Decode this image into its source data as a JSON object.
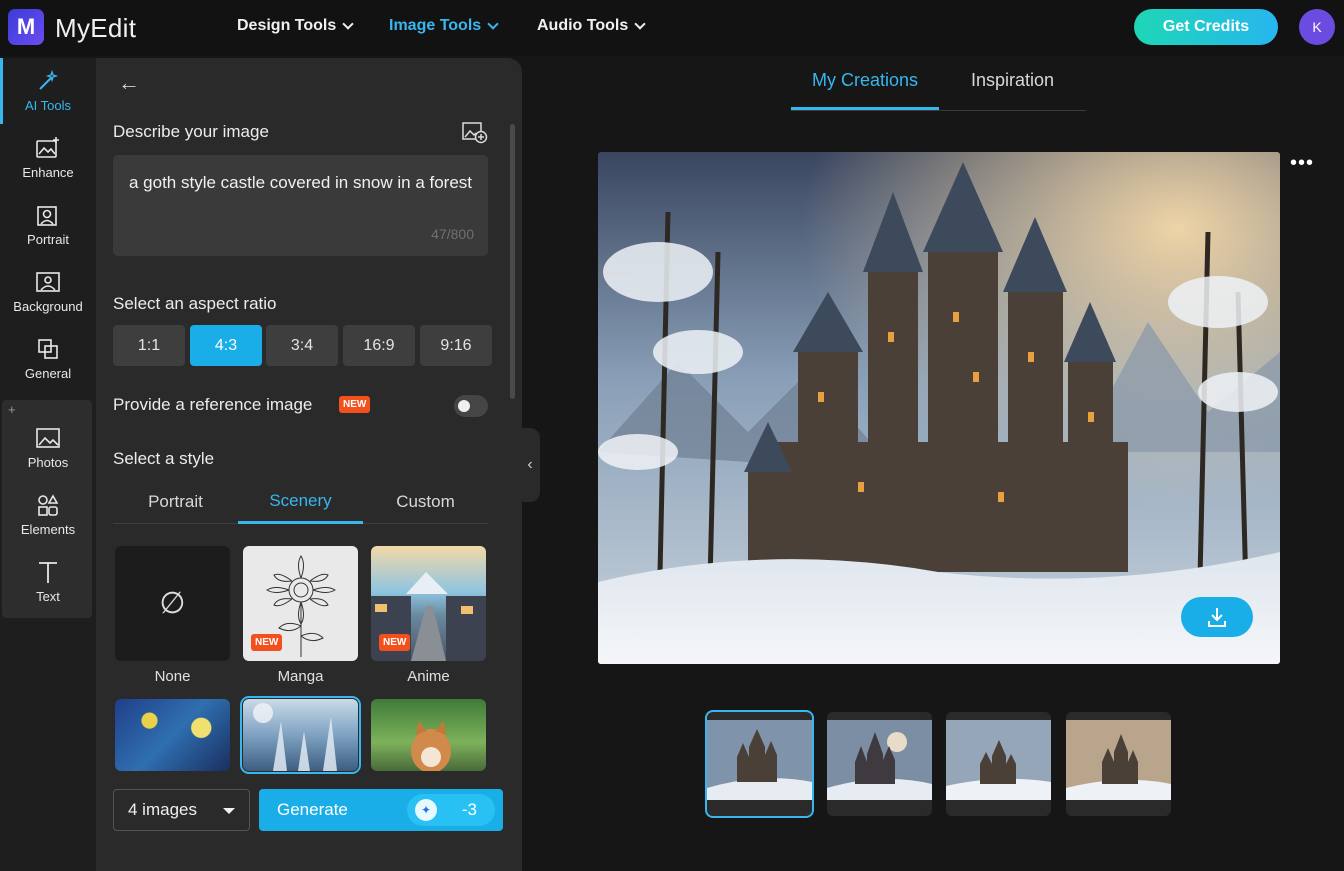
{
  "brand": {
    "name": "MyEdit",
    "mark": "M"
  },
  "nav": [
    {
      "label": "Design Tools"
    },
    {
      "label": "Image Tools"
    },
    {
      "label": "Audio Tools"
    }
  ],
  "header": {
    "credits_label": "Get Credits",
    "avatar_initial": "K"
  },
  "rail": {
    "items": [
      {
        "label": "AI Tools",
        "icon": "magic-wand-icon"
      },
      {
        "label": "Enhance",
        "icon": "image-enhance-icon"
      },
      {
        "label": "Portrait",
        "icon": "portrait-icon"
      },
      {
        "label": "Background",
        "icon": "background-icon"
      },
      {
        "label": "General",
        "icon": "general-icon"
      },
      {
        "label": "Photos",
        "icon": "photos-icon"
      },
      {
        "label": "Elements",
        "icon": "elements-icon"
      },
      {
        "label": "Text",
        "icon": "text-icon"
      }
    ],
    "group_plus": "+"
  },
  "panel": {
    "describe_label": "Describe your image",
    "prompt": "a goth style castle covered in snow in a forest",
    "char_count": "47/800",
    "aspect_label": "Select an aspect ratio",
    "ratios": [
      "1:1",
      "4:3",
      "3:4",
      "16:9",
      "9:16"
    ],
    "selected_ratio": "4:3",
    "reference_label": "Provide a reference image",
    "new_badge": "NEW",
    "reference_enabled": false,
    "style_label": "Select a style",
    "style_tabs": [
      "Portrait",
      "Scenery",
      "Custom"
    ],
    "active_style_tab": "Scenery",
    "styles": [
      {
        "label": "None",
        "new": false
      },
      {
        "label": "Manga",
        "new": true
      },
      {
        "label": "Anime",
        "new": true
      }
    ],
    "none_symbol": "∅",
    "count_value": "4 images",
    "generate_label": "Generate",
    "generate_cost": "-3",
    "back_arrow": "←",
    "collapse_arrow": "‹"
  },
  "main": {
    "tabs": [
      "My Creations",
      "Inspiration"
    ],
    "active_tab": "My Creations",
    "more": "•••"
  },
  "colors": {
    "accent": "#39b6ee",
    "button": "#1aaee8",
    "badge": "#f2511e",
    "credits_from": "#1ed7b5",
    "credits_to": "#27b6f0"
  }
}
